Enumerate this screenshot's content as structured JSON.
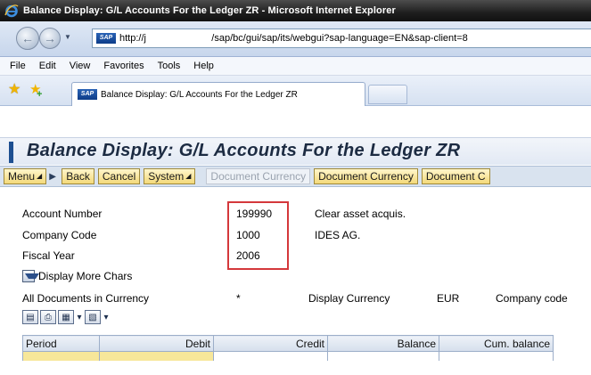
{
  "window": {
    "title": "Balance Display: G/L Accounts For the Ledger ZR - Microsoft Internet Explorer"
  },
  "address": {
    "url": "http://j                        /sap/bc/gui/sap/its/webgui?sap-language=EN&sap-client=8"
  },
  "menu": {
    "items": [
      "File",
      "Edit",
      "View",
      "Favorites",
      "Tools",
      "Help"
    ]
  },
  "tab": {
    "label": "Balance Display: G/L Accounts For the Ledger ZR"
  },
  "sap": {
    "title": "Balance Display: G/L Accounts For the Ledger ZR",
    "toolbar": {
      "menu": "Menu",
      "back": "Back",
      "cancel": "Cancel",
      "system": "System",
      "doc_currency_disabled": "Document Currency",
      "doc_currency": "Document Currency",
      "doc_cut": "Document C"
    },
    "fields": {
      "account_number_label": "Account Number",
      "account_number_value": "199990",
      "account_number_desc": "Clear asset acquis.",
      "company_code_label": "Company Code",
      "company_code_value": "1000",
      "company_code_desc": "IDES AG.",
      "fiscal_year_label": "Fiscal Year",
      "fiscal_year_value": "2006"
    },
    "display_more_chars": "Display More Chars",
    "info": {
      "all_docs": "All Documents in Currency",
      "star": "*",
      "display_currency_label": "Display Currency",
      "display_currency_value": "EUR",
      "company_code_cut": "Company code"
    },
    "table": {
      "columns": [
        "Period",
        "Debit",
        "Credit",
        "Balance",
        "Cum. balance"
      ]
    }
  },
  "colors": {
    "highlight": "#d4383b",
    "title_accent": "#1d4f91",
    "button_fill": "#f3d97a"
  }
}
